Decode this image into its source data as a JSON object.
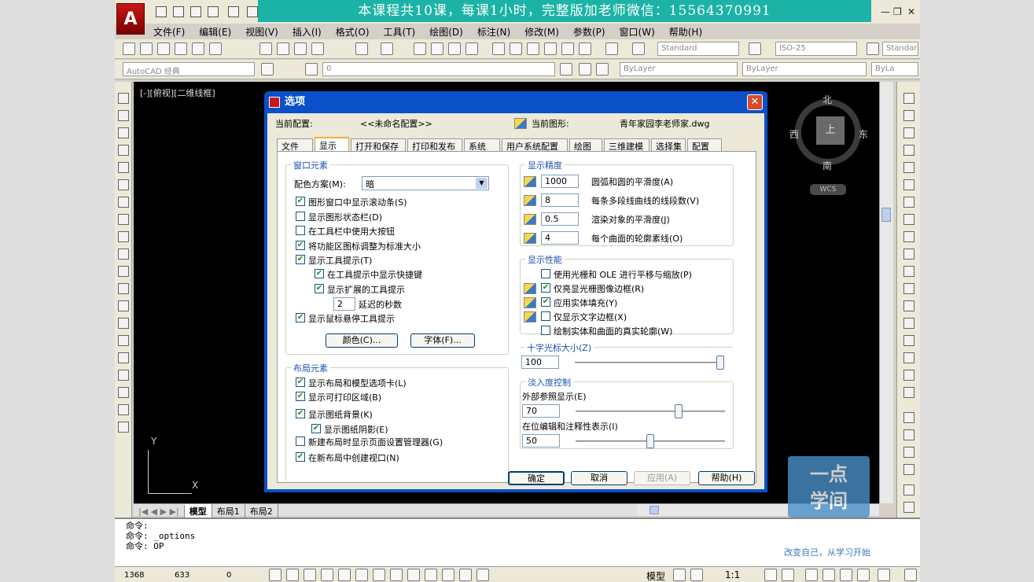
{
  "banner": "本课程共10课，每课1小时，完整版加老师微信：15564370991",
  "app": {
    "logo_letter": "A",
    "window_controls": [
      "—",
      "❐",
      "✕"
    ]
  },
  "menu": [
    "文件(F)",
    "编辑(E)",
    "视图(V)",
    "插入(I)",
    "格式(O)",
    "工具(T)",
    "绘图(D)",
    "标注(N)",
    "修改(M)",
    "参数(P)",
    "窗口(W)",
    "帮助(H)"
  ],
  "toolbar": {
    "text_style": "Standard",
    "dim_style": "ISO-25",
    "table_style": "Standard",
    "workspace": "AutoCAD 经典",
    "layer": "0",
    "color": "ByLayer",
    "linetype": "ByLayer",
    "lineweight": "ByLa"
  },
  "canvas": {
    "view_label": "[-][俯视][二维线框]",
    "compass": {
      "north": "北",
      "south": "南",
      "east": "东",
      "west": "西",
      "top": "上",
      "wcs": "WCS"
    },
    "ucs_y": "Y",
    "ucs_x": "X"
  },
  "layout_tabs": [
    "模型",
    "布局1",
    "布局2"
  ],
  "command": {
    "lines": [
      "命令:",
      "命令: _options",
      "命令: OP"
    ]
  },
  "status": {
    "x": "1368",
    "y": "633",
    "z": "0",
    "model": "模型",
    "scale": "1:1"
  },
  "watermark": {
    "line1": "一点",
    "line2": "学间",
    "slogan": "改变自己，从学习开始"
  },
  "dialog": {
    "title": "选项",
    "close": "✕",
    "current_profile_label": "当前配置:",
    "current_profile": "<<未命名配置>>",
    "current_drawing_label": "当前图形:",
    "current_drawing": "青年家园李老师家.dwg",
    "tabs": [
      "文件",
      "显示",
      "打开和保存",
      "打印和发布",
      "系统",
      "用户系统配置",
      "绘图",
      "三维建模",
      "选择集",
      "配置"
    ],
    "window_elements": {
      "title": "窗口元素",
      "color_scheme_label": "配色方案(M):",
      "color_scheme": "暗",
      "checks": [
        {
          "label": "图形窗口中显示滚动条(S)",
          "checked": true
        },
        {
          "label": "显示图形状态栏(D)",
          "checked": false
        },
        {
          "label": "在工具栏中使用大按钮",
          "checked": false
        },
        {
          "label": "将功能区图标调整为标准大小",
          "checked": true
        },
        {
          "label": "显示工具提示(T)",
          "checked": true
        },
        {
          "label": "在工具提示中显示快捷键",
          "checked": true
        },
        {
          "label": "显示扩展的工具提示",
          "checked": true
        },
        {
          "label": "显示鼠标悬停工具提示",
          "checked": true
        }
      ],
      "delay_value": "2",
      "delay_label": "延迟的秒数",
      "colors_button": "颜色(C)...",
      "fonts_button": "字体(F)..."
    },
    "layout_elements": {
      "title": "布局元素",
      "checks": [
        {
          "label": "显示布局和模型选项卡(L)",
          "checked": true
        },
        {
          "label": "显示可打印区域(B)",
          "checked": true
        },
        {
          "label": "显示图纸背景(K)",
          "checked": true
        },
        {
          "label": "显示图纸阴影(E)",
          "checked": true
        },
        {
          "label": "新建布局时显示页面设置管理器(G)",
          "checked": false
        },
        {
          "label": "在新布局中创建视口(N)",
          "checked": true
        }
      ]
    },
    "resolution": {
      "title": "显示精度",
      "rows": [
        {
          "value": "1000",
          "label": "圆弧和圆的平滑度(A)"
        },
        {
          "value": "8",
          "label": "每条多段线曲线的线段数(V)"
        },
        {
          "value": "0.5",
          "label": "渲染对象的平滑度(J)"
        },
        {
          "value": "4",
          "label": "每个曲面的轮廓素线(O)"
        }
      ]
    },
    "performance": {
      "title": "显示性能",
      "checks": [
        {
          "label": "使用光栅和 OLE 进行平移与缩放(P)",
          "checked": false
        },
        {
          "label": "仅亮显光栅图像边框(R)",
          "checked": true
        },
        {
          "label": "应用实体填充(Y)",
          "checked": true
        },
        {
          "label": "仅显示文字边框(X)",
          "checked": false
        },
        {
          "label": "绘制实体和曲面的真实轮廓(W)",
          "checked": false
        }
      ]
    },
    "crosshair": {
      "title": "十字光标大小(Z)",
      "value": "100",
      "level": 100
    },
    "fade": {
      "title": "淡入度控制",
      "xref_label": "外部参照显示(E)",
      "xref_value": "70",
      "xref_level": 70,
      "inplace_label": "在位编辑和注释性表示(I)",
      "inplace_value": "50",
      "inplace_level": 50
    },
    "buttons": {
      "ok": "确定",
      "cancel": "取消",
      "apply": "应用(A)",
      "help": "帮助(H)"
    }
  }
}
